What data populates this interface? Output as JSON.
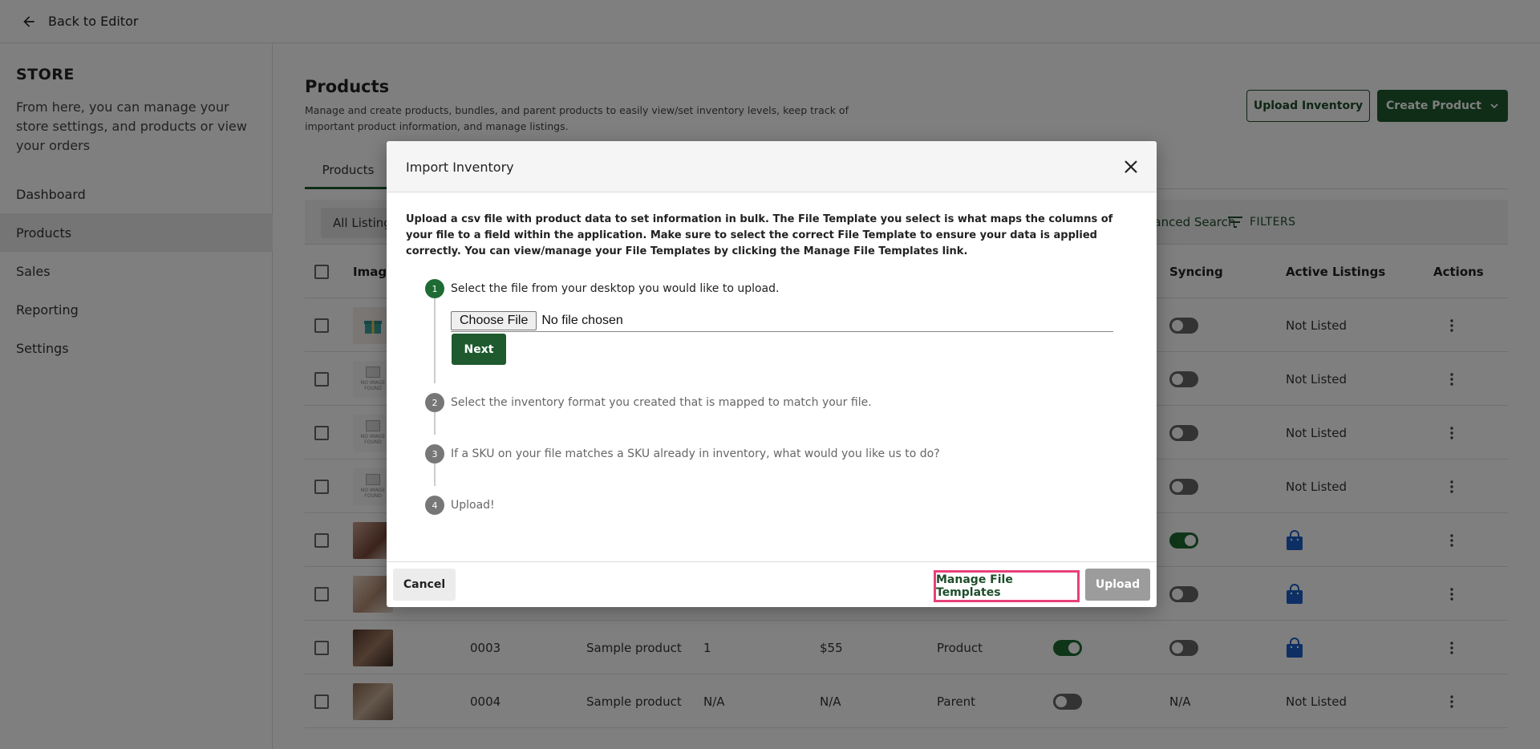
{
  "topbar": {
    "back_label": "Back to Editor"
  },
  "sidebar": {
    "title": "STORE",
    "description": "From here, you can manage your store settings, and products or view your orders",
    "items": [
      {
        "label": "Dashboard",
        "active": false
      },
      {
        "label": "Products",
        "active": true
      },
      {
        "label": "Sales",
        "active": false
      },
      {
        "label": "Reporting",
        "active": false
      },
      {
        "label": "Settings",
        "active": false
      }
    ]
  },
  "main": {
    "title": "Products",
    "description": "Manage and create products, bundles, and parent products to easily view/set inventory levels, keep track of important product information, and manage listings.",
    "upload_inventory_label": "Upload Inventory",
    "create_product_label": "Create Product",
    "tab_label": "Products",
    "filter_chip": "All Listing",
    "advanced_search_label": "Advanced Search",
    "filters_label": "FILTERS",
    "columns": {
      "image": "Image",
      "syncing": "Syncing",
      "active_listings": "Active Listings",
      "actions": "Actions"
    },
    "rows": [
      {
        "sku": "",
        "name": "",
        "qty": "",
        "price": "",
        "type": "",
        "thumb": "gift",
        "syncing": false,
        "listing": "Not Listed"
      },
      {
        "sku": "",
        "name": "",
        "qty": "",
        "price": "",
        "type": "",
        "thumb": "noimg",
        "syncing": false,
        "listing": "Not Listed"
      },
      {
        "sku": "",
        "name": "",
        "qty": "",
        "price": "",
        "type": "",
        "thumb": "noimg",
        "syncing": false,
        "listing": "Not Listed"
      },
      {
        "sku": "",
        "name": "",
        "qty": "",
        "price": "",
        "type": "",
        "thumb": "noimg",
        "syncing": false,
        "listing": "Not Listed"
      },
      {
        "sku": "",
        "name": "",
        "qty": "",
        "price": "",
        "type": "",
        "thumb": "photo1",
        "syncing": true,
        "listing": "bag"
      },
      {
        "sku": "",
        "name": "",
        "qty": "",
        "price": "",
        "type": "",
        "thumb": "photo2",
        "syncing": false,
        "listing": "bag"
      },
      {
        "sku": "0003",
        "name": "Sample product",
        "qty": "1",
        "price": "$55",
        "type": "Product",
        "thumb": "photo3",
        "active": true,
        "syncing": false,
        "listing": "bag"
      },
      {
        "sku": "0004",
        "name": "Sample product",
        "qty": "N/A",
        "price": "N/A",
        "type": "Parent",
        "thumb": "photo4",
        "active": false,
        "syncing_text": "N/A",
        "listing": "Not Listed"
      }
    ],
    "noimg_text": "NO IMAGE FOUND"
  },
  "modal": {
    "title": "Import Inventory",
    "description": "Upload a csv file with product data to set information in bulk. The File Template you select is what maps the columns of your file to a field within the application. Make sure to select the correct File Template to ensure your data is applied correctly. You can view/manage your File Templates by clicking the Manage File Templates link.",
    "steps": [
      {
        "num": "1",
        "label": "Select the file from your desktop you would like to upload."
      },
      {
        "num": "2",
        "label": "Select the inventory format you created that is mapped to match your file."
      },
      {
        "num": "3",
        "label": "If a SKU on your file matches a SKU already in inventory, what would you like us to do?"
      },
      {
        "num": "4",
        "label": "Upload!"
      }
    ],
    "choose_file_label": "Choose File",
    "file_status": "No file chosen",
    "next_label": "Next",
    "cancel_label": "Cancel",
    "manage_label": "Manage File Templates",
    "upload_label": "Upload"
  },
  "colors": {
    "brand_green": "#1e5a2e",
    "highlight": "#e8407a",
    "bag_blue": "#1a5fc8"
  }
}
